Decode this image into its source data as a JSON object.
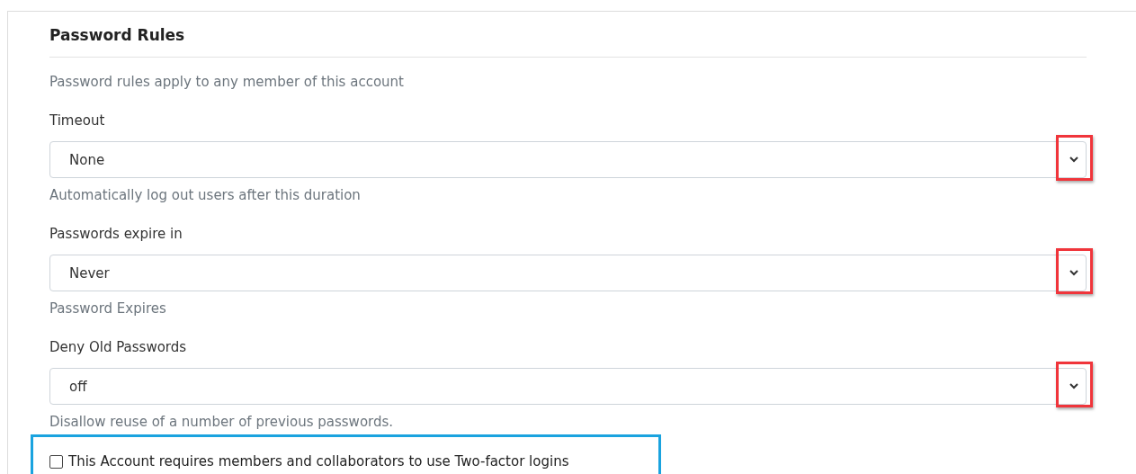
{
  "section": {
    "title": "Password Rules",
    "description": "Password rules apply to any member of this account"
  },
  "fields": [
    {
      "label": "Timeout",
      "value": "None",
      "help": "Automatically log out users after this duration",
      "highlighted": true
    },
    {
      "label": "Passwords expire in",
      "value": "Never",
      "help": "Password Expires",
      "highlighted": true
    },
    {
      "label": "Deny Old Passwords",
      "value": "off",
      "help": "Disallow reuse of a number of previous passwords.",
      "highlighted": true
    }
  ],
  "checkbox": {
    "label": "This Account requires members and collaborators to use Two-factor logins",
    "checked": false,
    "highlighted": true
  }
}
